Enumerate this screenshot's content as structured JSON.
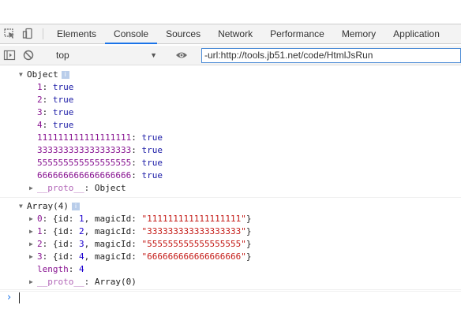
{
  "tabs": [
    {
      "label": "Elements"
    },
    {
      "label": "Console"
    },
    {
      "label": "Sources"
    },
    {
      "label": "Network"
    },
    {
      "label": "Performance"
    },
    {
      "label": "Memory"
    },
    {
      "label": "Application"
    }
  ],
  "toolbar": {
    "context": "top",
    "filter_value": "-url:http://tools.jb51.net/code/HtmlJsRun"
  },
  "console": {
    "object": {
      "title": "Object",
      "info": "i",
      "props": [
        {
          "key": "1",
          "value": "true"
        },
        {
          "key": "2",
          "value": "true"
        },
        {
          "key": "3",
          "value": "true"
        },
        {
          "key": "4",
          "value": "true"
        },
        {
          "key": "111111111111111111",
          "value": "true"
        },
        {
          "key": "333333333333333333",
          "value": "true"
        },
        {
          "key": "555555555555555555",
          "value": "true"
        },
        {
          "key": "666666666666666666",
          "value": "true"
        }
      ],
      "proto_key": "__proto__",
      "proto_value": "Object"
    },
    "array": {
      "title": "Array(4)",
      "info": "i",
      "items": [
        {
          "index": "0",
          "id": "1",
          "magicId": "\"111111111111111111\""
        },
        {
          "index": "1",
          "id": "2",
          "magicId": "\"333333333333333333\""
        },
        {
          "index": "2",
          "id": "3",
          "magicId": "\"555555555555555555\""
        },
        {
          "index": "3",
          "id": "4",
          "magicId": "\"666666666666666666\""
        }
      ],
      "length_key": "length",
      "length_value": "4",
      "proto_key": "__proto__",
      "proto_value": "Array(0)"
    }
  }
}
